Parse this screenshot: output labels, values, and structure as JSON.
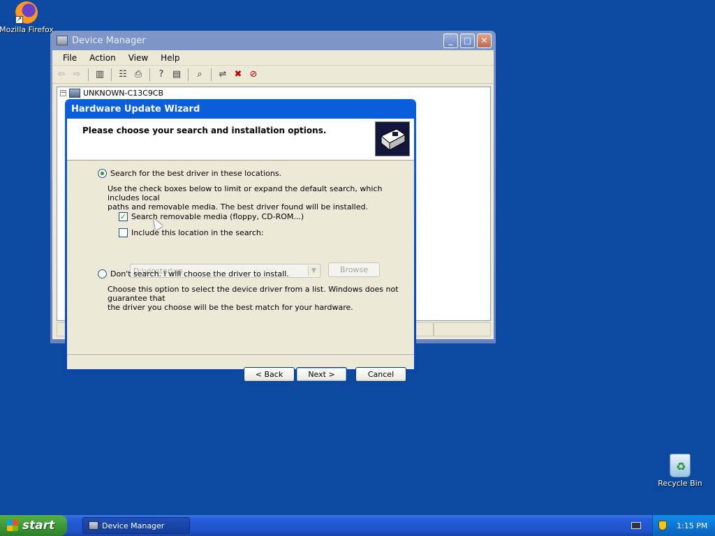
{
  "desktop": {
    "icons": [
      {
        "label": "Mozilla Firefox"
      },
      {
        "label": "Recycle Bin"
      }
    ]
  },
  "device_manager": {
    "title": "Device Manager",
    "menu": [
      "File",
      "Action",
      "View",
      "Help"
    ],
    "tree_root": "UNKNOWN-C13C9CB"
  },
  "wizard": {
    "title": "Hardware Update Wizard",
    "heading": "Please choose your search and installation options.",
    "option_search": {
      "label": "Search for the best driver in these locations.",
      "selected": true,
      "description_line1": "Use the check boxes below to limit or expand the default search, which includes local",
      "description_line2": "paths and removable media. The best driver found will be installed."
    },
    "check_removable": {
      "label": "Search removable media (floppy, CD-ROM...)",
      "checked": true
    },
    "check_location": {
      "label": "Include this location in the search:",
      "checked": false
    },
    "location_value": "D:\\viostor\\xp",
    "browse_label": "Browse",
    "option_manual": {
      "label": "Don't search. I will choose the driver to install.",
      "selected": false,
      "description_line1": "Choose this option to select the device driver from a list.  Windows does not guarantee that",
      "description_line2": "the driver you choose will be the best match for your hardware."
    },
    "buttons": {
      "back": "< Back",
      "next": "Next >",
      "cancel": "Cancel"
    }
  },
  "taskbar": {
    "start_label": "start",
    "task_label": "Device Manager",
    "clock": "1:15 PM"
  },
  "colors": {
    "desktop": "#0b4aa0",
    "title_active": "#0843b8",
    "dialog_face": "#ece9d8"
  }
}
